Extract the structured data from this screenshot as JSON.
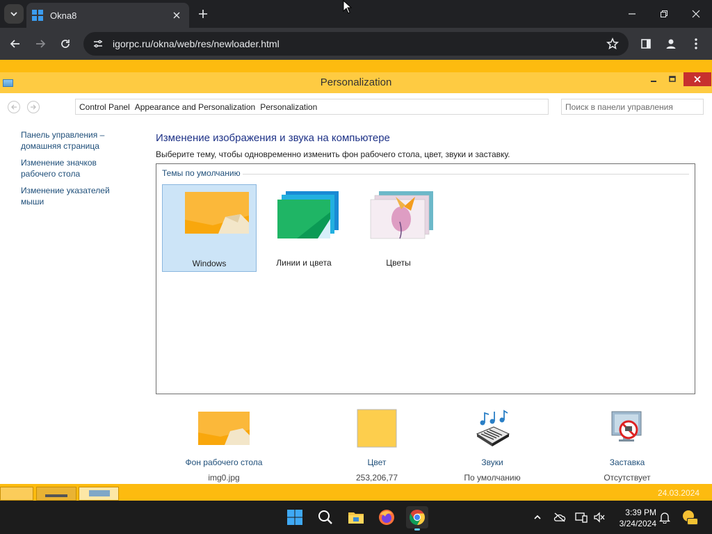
{
  "browser": {
    "tab_title": "Okna8",
    "url": "igorpc.ru/okna/web/res/newloader.html"
  },
  "window": {
    "title": "Personalization",
    "breadcrumb": [
      "Control Panel",
      "Appearance and Personalization",
      "Personalization"
    ],
    "search_placeholder": "Поиск в панели управления"
  },
  "sidebar": {
    "links": [
      "Панель управления – домашняя страница",
      "Изменение значков рабочего стола",
      "Изменение указателей мыши"
    ]
  },
  "main": {
    "heading": "Изменение изображения и звука на компьютере",
    "subtitle": "Выберите тему, чтобы одновременно изменить фон рабочего стола, цвет, звуки и заставку.",
    "group_label": "Темы по умолчанию",
    "themes": [
      {
        "label": "Windows",
        "selected": true
      },
      {
        "label": "Линии и цвета",
        "selected": false
      },
      {
        "label": "Цветы",
        "selected": false
      }
    ]
  },
  "bottom": {
    "items": [
      {
        "label": "Фон рабочего стола",
        "value": "img0.jpg",
        "icon": "wallpaper-icon"
      },
      {
        "label": "Цвет",
        "value": "253,206,77",
        "icon": "color-swatch-icon",
        "color": "#fdce4d"
      },
      {
        "label": "Звуки",
        "value": "По умолчанию",
        "icon": "sounds-icon"
      },
      {
        "label": "Заставка",
        "value": "Отсутствует",
        "icon": "screensaver-icon"
      }
    ]
  },
  "win8_taskbar": {
    "date": "24.03.2024"
  },
  "system_tray": {
    "time": "3:39 PM",
    "date": "3/24/2024"
  },
  "colors": {
    "accent": "#fdbb0f",
    "title_bar": "#fecb42",
    "link": "#1e4e79"
  }
}
